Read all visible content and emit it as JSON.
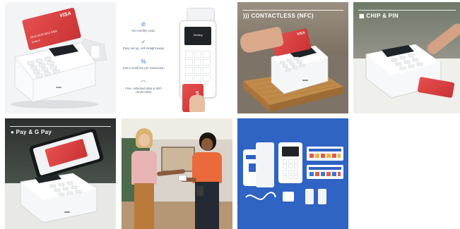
{
  "tiles": {
    "terminal_visa": {
      "card_brand": "VISA",
      "card_number": "4234 5678 9012 3456",
      "card_holder": "SUMUP"
    },
    "features": {
      "screen_label": "Sending",
      "card_brand": "VISA",
      "items": [
        {
          "text": "No monthly costs",
          "icon": "euro-off-icon"
        },
        {
          "text": "Easy set-up, sell straight away",
          "icon": "check-circle-icon"
        },
        {
          "text": "Just a small fee per transaction",
          "icon": "percent-icon"
        },
        {
          "text": "Free, unlimited data & WiFi connectivity",
          "icon": "wifi-icon"
        }
      ]
    },
    "contactless": {
      "caption": "CONTACTLESS (NFC)",
      "caption_icon": "contactless-icon",
      "card_brand": "VISA"
    },
    "chip_pin": {
      "caption": "CHIP & PIN",
      "caption_icon": "chip-icon"
    },
    "wallets": {
      "caption": "Pay & G Pay",
      "caption_icon": "apple-logo-icon"
    },
    "in_store": {},
    "kit": {}
  },
  "colors": {
    "brand_red": "#d83a3a",
    "brand_blue": "#2f63c4",
    "feature_blue": "#3a78d6"
  }
}
